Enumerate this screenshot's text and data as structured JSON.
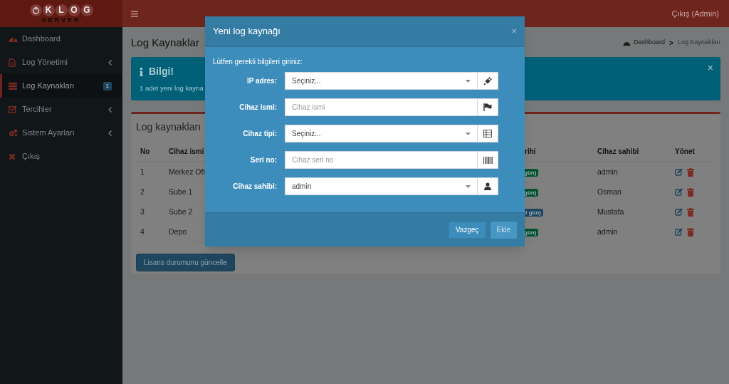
{
  "logo": {
    "letters": [
      "K",
      "L",
      "O",
      "G"
    ],
    "subtitle": "SERVER"
  },
  "topbar": {
    "user_link": "Çıkış (Admin)"
  },
  "sidebar": {
    "items": [
      {
        "label": "Dashboard",
        "selected": false,
        "expandable": false
      },
      {
        "label": "Log Yönetimi",
        "selected": false,
        "expandable": true
      },
      {
        "label": "Log Kaynakları",
        "selected": true,
        "expandable": false,
        "badge": "1"
      },
      {
        "label": "Tercihler",
        "selected": false,
        "expandable": true
      },
      {
        "label": "Sistem Ayarları",
        "selected": false,
        "expandable": true
      },
      {
        "label": "Çıkış",
        "selected": false,
        "expandable": false
      }
    ]
  },
  "page": {
    "title": "Log Kaynaklar",
    "breadcrumb": [
      "Dashboard",
      "Log Kaynakları"
    ],
    "breadcrumb_separator": ">",
    "alert": {
      "title": "Bilgi!",
      "text": "1 adet yeni log kayna",
      "close": "×"
    },
    "box": {
      "title": "Log kaynakları",
      "columns": [
        "No",
        "Cihaz ismi",
        "rihi",
        "Cihaz sahibi",
        "Yönet"
      ],
      "rows": [
        {
          "no": "1",
          "name": "Merkez Ofi",
          "badge": "gün)",
          "color": "#00532d",
          "owner": "admin"
        },
        {
          "no": "2",
          "name": "Sube 1",
          "badge": "gün)",
          "color": "#00532d",
          "owner": "Osman"
        },
        {
          "no": "3",
          "name": "Sube 2",
          "badge": "0 gün)",
          "color": "#1e475e",
          "owner": "Mustafa"
        },
        {
          "no": "4",
          "name": "Depo",
          "badge": "gün)",
          "color": "#00532d",
          "owner": "admin"
        }
      ],
      "button": "Lisans durumunu güncelle"
    }
  },
  "modal": {
    "title": "Yeni log kaynağı",
    "close": "×",
    "intro": "Lütfen gerekli bilgileri giriniz:",
    "fields": [
      {
        "label": "IP adres:",
        "kind": "select",
        "value": "Seçiniz..."
      },
      {
        "label": "Cihaz ismi:",
        "kind": "input",
        "placeholder": "Cihaz ismi"
      },
      {
        "label": "Cihaz tipi:",
        "kind": "select",
        "value": "Seçiniz..."
      },
      {
        "label": "Seri no:",
        "kind": "input",
        "placeholder": "Cihaz seri no"
      },
      {
        "label": "Cihaz sahibi:",
        "kind": "select",
        "value": "admin"
      }
    ],
    "buttons": [
      {
        "label": "Vazgeç",
        "disabled": false
      },
      {
        "label": "Ekle",
        "disabled": true
      }
    ]
  }
}
